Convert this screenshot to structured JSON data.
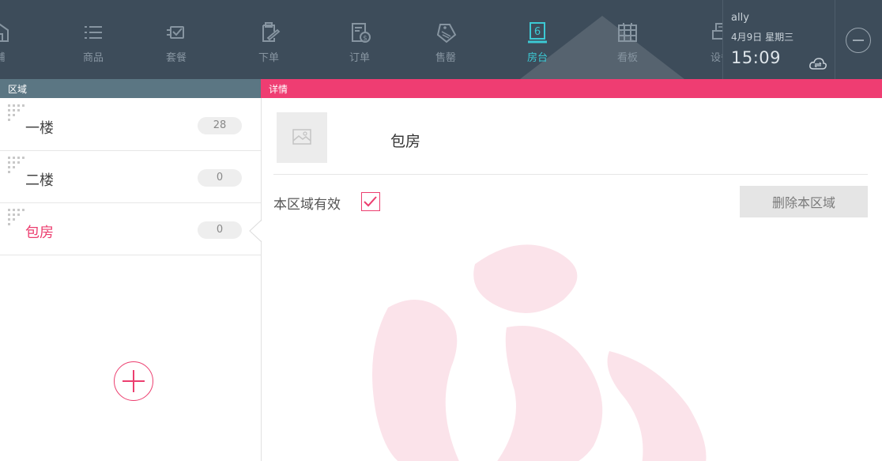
{
  "nav": {
    "items": [
      {
        "label": "铺",
        "icon": "store-icon"
      },
      {
        "label": "商品",
        "icon": "list-icon"
      },
      {
        "label": "套餐",
        "icon": "combo-icon"
      },
      {
        "label": "下单",
        "icon": "clipboard-edit-icon"
      },
      {
        "label": "订单",
        "icon": "order-receipt-icon"
      },
      {
        "label": "售罄",
        "icon": "sold-out-tag-icon"
      },
      {
        "label": "房台",
        "icon": "table-6-icon",
        "badge": "6",
        "active": true
      },
      {
        "label": "看板",
        "icon": "calendar-board-icon"
      },
      {
        "label": "设备",
        "icon": "printer-icon"
      }
    ],
    "active_color": "#3cc9d4"
  },
  "user": {
    "name": "ally",
    "date": "4月9日 星期三",
    "time": "15:09",
    "sync_icon": "cloud-sync-icon",
    "logout_icon": "minus-circle-icon"
  },
  "left_panel": {
    "title": "区域",
    "areas": [
      {
        "name": "一楼",
        "count": "28",
        "selected": false
      },
      {
        "name": "二楼",
        "count": "0",
        "selected": false
      },
      {
        "name": "包房",
        "count": "0",
        "selected": true
      }
    ],
    "add_icon": "plus-circle-icon"
  },
  "detail": {
    "title": "详情",
    "area_name": "包房",
    "image_icon": "image-placeholder-icon",
    "valid_label": "本区域有效",
    "valid_checked": true,
    "delete_label": "删除本区域"
  },
  "colors": {
    "topbar": "#3d4c5a",
    "accent": "#ef3d72",
    "left_header": "#5b7683"
  }
}
